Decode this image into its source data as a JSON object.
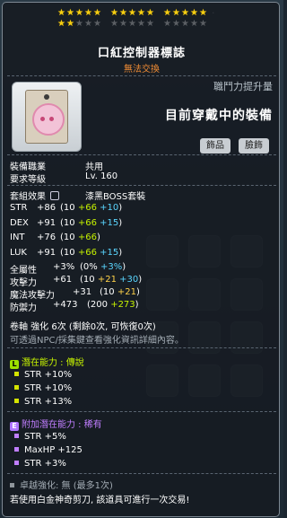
{
  "stars": {
    "row1_on": 15,
    "row2_on": 2,
    "row2_total": 15
  },
  "title": "口紅控制器標誌",
  "subtitle": "無法交換",
  "right_panel": {
    "atk_label": "職鬥力提升量",
    "equip_label": "目前穿戴中的裝備",
    "chip1": "飾品",
    "chip2": "臉飾"
  },
  "req": {
    "job_label": "裝備職業",
    "job_value": "共用",
    "lv_label": "要求等級",
    "lv_value": "Lv. 160"
  },
  "set": {
    "label": "套組效果",
    "value": "漆黑BOSS套裝"
  },
  "stats": [
    {
      "name": "STR",
      "total": "+86",
      "base": "10",
      "add1": "+66",
      "add2": "+10"
    },
    {
      "name": "DEX",
      "total": "+91",
      "base": "10",
      "add1": "+66",
      "add2": "+15"
    },
    {
      "name": "INT",
      "total": "+76",
      "base": "10",
      "add1": "+66",
      "add2": ""
    },
    {
      "name": "LUK",
      "total": "+91",
      "base": "10",
      "add1": "+66",
      "add2": "+15"
    }
  ],
  "all_stat": {
    "name": "全屬性",
    "total": "+3%",
    "base": "0%",
    "add": "+3%"
  },
  "atk": {
    "name": "攻擊力",
    "total": "+61",
    "base": "10",
    "add1": "+21",
    "add2": "+30"
  },
  "matk": {
    "name": "魔法攻擊力",
    "total": "+31",
    "base": "10",
    "add1": "+21"
  },
  "def": {
    "name": "防禦力",
    "total": "+473",
    "base": "200",
    "add1": "+273"
  },
  "scroll": {
    "text": "卷軸 強化 6次 (剩餘0次, 可恢復0次)",
    "note": "可透過NPC/採集鍵查看強化資訊詳細內容。"
  },
  "potential": {
    "badge": "L",
    "label": "潛在能力",
    "grade": "傳說",
    "lines": [
      "STR +10%",
      "STR +10%",
      "STR +13%"
    ]
  },
  "bonus": {
    "badge": "E",
    "label": "附加潛在能力",
    "grade": "稀有",
    "lines": [
      "STR +5%",
      "MaxHP +125",
      "STR +3%"
    ]
  },
  "soul": {
    "text": "卓越強化: 無 (最多1次)"
  },
  "footer": "若使用白金神奇剪刀, 該道具可進行一次交易!"
}
